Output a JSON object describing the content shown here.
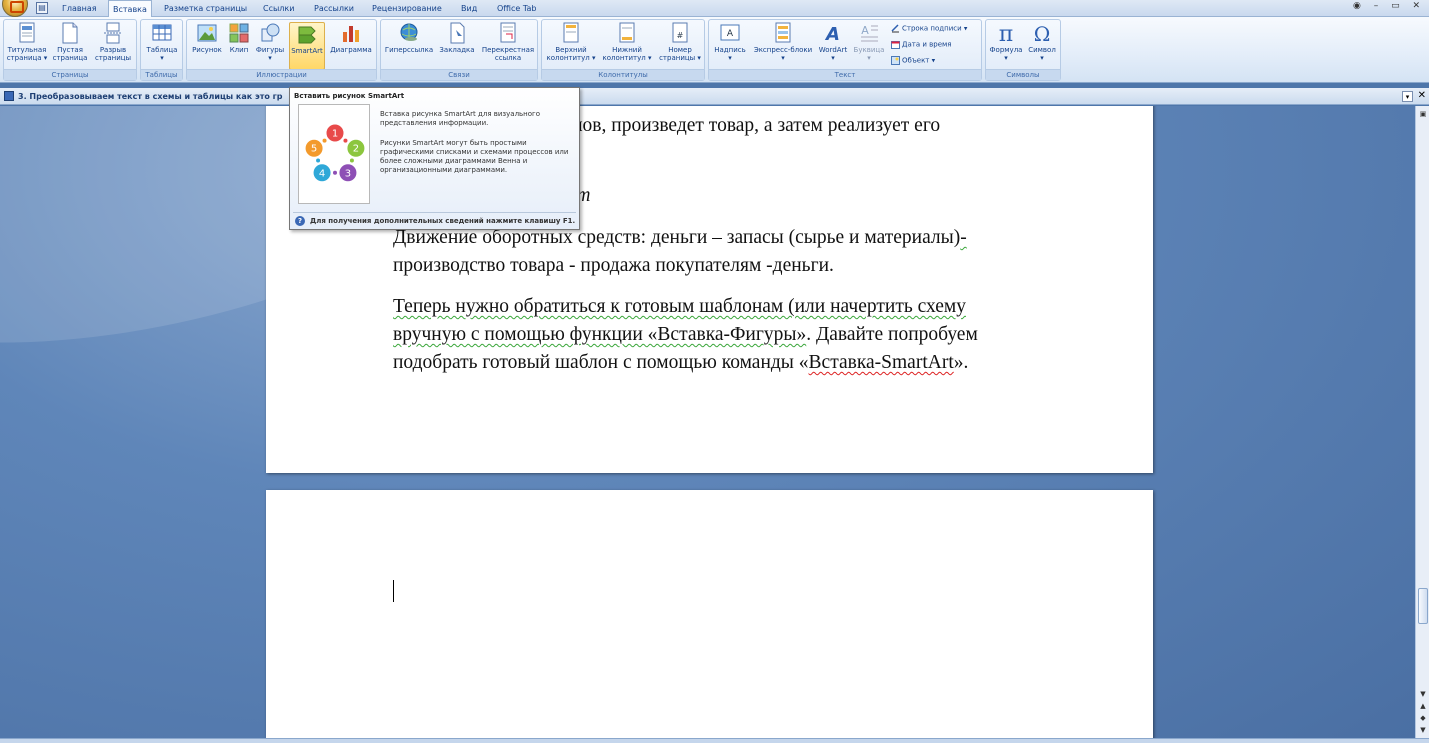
{
  "tabs": [
    "Главная",
    "Вставка",
    "Разметка страницы",
    "Ссылки",
    "Рассылки",
    "Рецензирование",
    "Вид",
    "Office Tab"
  ],
  "active_tab": "Вставка",
  "window_controls": "◉ – ▭ ✕",
  "ribbon": {
    "pages": {
      "label": "Страницы",
      "title_page": "Титульная\nстраница ▾",
      "blank_page": "Пустая\nстраница",
      "page_break": "Разрыв\nстраницы"
    },
    "tables": {
      "label": "Таблицы",
      "table": "Таблица\n▾"
    },
    "illustrations": {
      "label": "Иллюстрации",
      "picture": "Рисунок",
      "clip": "Клип",
      "shapes": "Фигуры\n▾",
      "smartart": "SmartArt",
      "chart": "Диаграмма"
    },
    "links": {
      "label": "Связи",
      "hyperlink": "Гиперссылка",
      "bookmark": "Закладка",
      "cross_ref": "Перекрестная\nссылка"
    },
    "header_footer": {
      "label": "Колонтитулы",
      "header": "Верхний\nколонтитул ▾",
      "footer": "Нижний\nколонтитул ▾",
      "page_number": "Номер\nстраницы ▾"
    },
    "text": {
      "label": "Текст",
      "textbox": "Надпись\n▾",
      "quick_parts": "Экспресс-блоки\n▾",
      "wordart": "WordArt\n▾",
      "drop_cap": "Буквица\n▾",
      "signature_line": "Строка подписи ▾",
      "date_time": "Дата и время",
      "object": "Объект ▾"
    },
    "symbols": {
      "label": "Символы",
      "equation": "Формула\n▾",
      "symbol": "Символ\n▾"
    }
  },
  "doc_tab": {
    "title": "3. Преобразовываем текст в схемы и таблицы как это гр",
    "dropdown": "▾",
    "close": "✕"
  },
  "document": {
    "line1": "алов, произведет товар, а затем реализует его",
    "line2": "ет",
    "para1_line1_a": "Движение оборотных средств: деньги – запасы (сырье и материалы)",
    "para1_line1_b": "-",
    "para1_line2": "производство товара - продажа покупателям -деньги.",
    "para2_line1": "Теперь нужно обратиться к готовым шаблонам (или начертить схему",
    "para2_line2_a": "вручную с помощью функции «Вставка-Фигуры»",
    "para2_line2_b": ". Давайте попробуем",
    "para2_line3_a": "подобрать готовый шаблон с помощью команды «",
    "para2_line3_b": "Вставка-SmartArt",
    "para2_line3_c": "»."
  },
  "tooltip": {
    "title": "Вставить рисунок SmartArt",
    "desc1": "Вставка рисунка SmartArt для визуального представления информации.",
    "desc2": "Рисунки SmartArt могут быть простыми графическими списками и схемами процессов или более сложными диаграммами Венна и организационными диаграммами.",
    "help": "Для получения дополнительных сведений нажмите клавишу F1.",
    "cycle_numbers": [
      "1",
      "2",
      "3",
      "4",
      "5"
    ],
    "cycle_colors": [
      "#e84a4a",
      "#8cc63e",
      "#8e4fb5",
      "#2fa8d8",
      "#f39a2c"
    ]
  },
  "colors": {
    "accent": "#15428b",
    "workspace": "#4e76aa",
    "tooltip_hover": "#ffd767"
  }
}
